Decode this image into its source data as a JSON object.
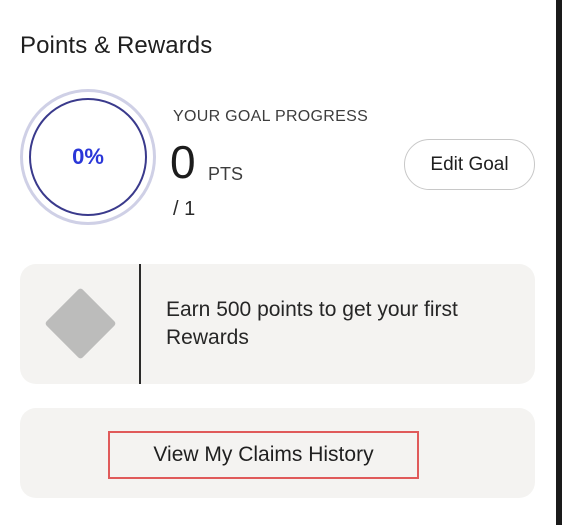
{
  "header": {
    "title": "Points & Rewards"
  },
  "goal": {
    "percent_label": "0%",
    "progress_fraction": 0,
    "label": "YOUR GOAL PROGRESS",
    "points": "0",
    "points_unit": "PTS",
    "target": "/ 1",
    "edit_label": "Edit Goal"
  },
  "earn": {
    "icon": "diamond-icon",
    "message": "Earn 500 points to get your first Rewards"
  },
  "claims": {
    "link_label": "View My Claims History"
  },
  "colors": {
    "accent": "#2a37d8",
    "card_bg": "#f4f3f1",
    "highlight": "#e05a5a"
  }
}
